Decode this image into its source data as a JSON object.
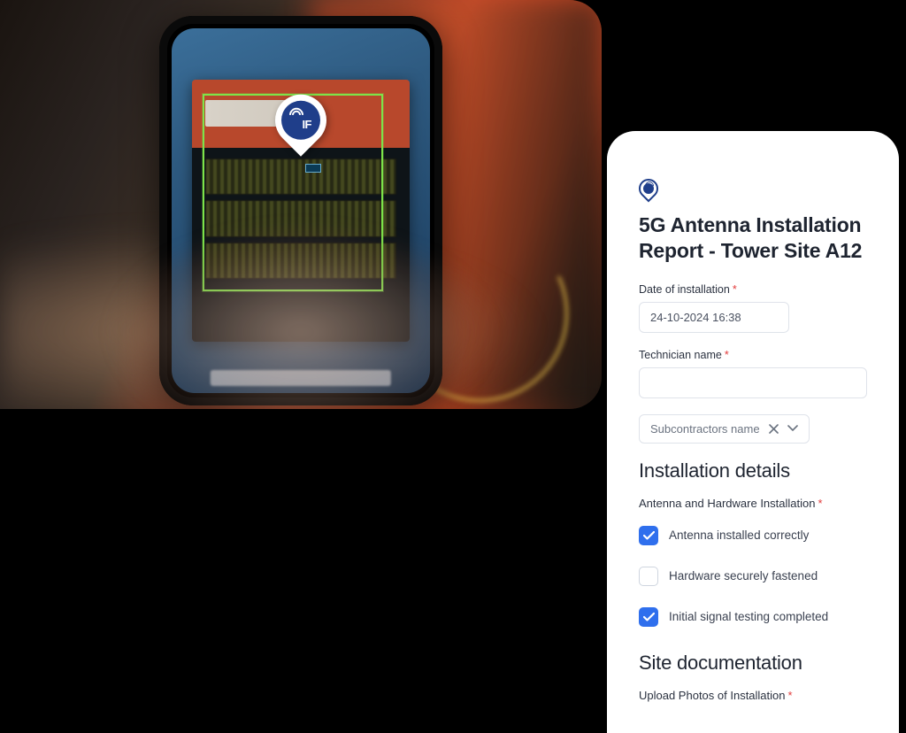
{
  "photo": {
    "pin_label": "IF"
  },
  "form": {
    "title": "5G Antenna Installation Report - Tower Site A12",
    "date_label": "Date of installation",
    "date_value": "24-10-2024 16:38",
    "tech_label": "Technician name",
    "tech_value": "",
    "subcontractor_chip": "Subcontractors name",
    "section_install": "Installation details",
    "hw_label": "Antenna and Hardware Installation",
    "checks": [
      {
        "label": "Antenna installed correctly",
        "checked": true
      },
      {
        "label": "Hardware securely fastened",
        "checked": false
      },
      {
        "label": "Initial signal testing completed",
        "checked": true
      }
    ],
    "section_docs": "Site documentation",
    "upload_label": "Upload Photos of Installation"
  }
}
